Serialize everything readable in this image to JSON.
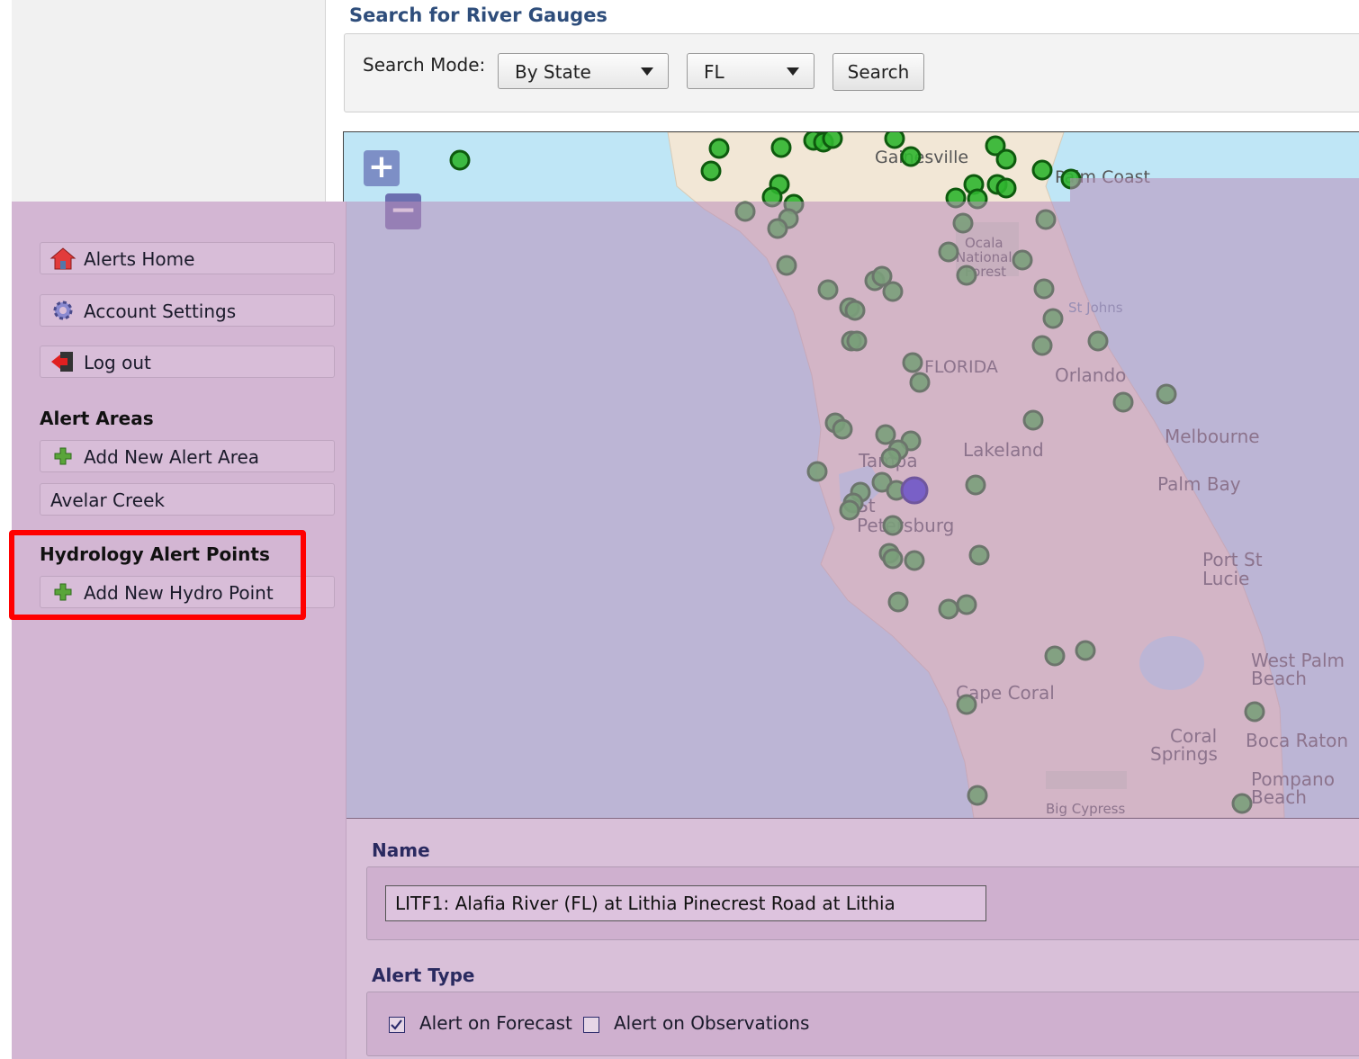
{
  "search": {
    "title": "Search for River Gauges",
    "mode_label": "Search Mode:",
    "mode_value": "By State",
    "state_value": "FL",
    "search_button": "Search"
  },
  "map": {
    "zoom_in": "+",
    "zoom_out": "−",
    "places": [
      {
        "id": "gainesville",
        "text": "Gainesville"
      },
      {
        "id": "palmcoast",
        "text": "Palm Coast"
      },
      {
        "id": "ocala",
        "text": "Ocala"
      },
      {
        "id": "ocala2",
        "text": "National"
      },
      {
        "id": "ocala3",
        "text": "Forest"
      },
      {
        "id": "stjohns",
        "text": "St Johns"
      },
      {
        "id": "florida",
        "text": "FLORIDA"
      },
      {
        "id": "orlando",
        "text": "Orlando"
      },
      {
        "id": "melbourne",
        "text": "Melbourne"
      },
      {
        "id": "lakeland",
        "text": "Lakeland"
      },
      {
        "id": "tampa",
        "text": "Tampa"
      },
      {
        "id": "palmbay",
        "text": "Palm Bay"
      },
      {
        "id": "st",
        "text": "St"
      },
      {
        "id": "petersburg",
        "text": "Petersburg"
      },
      {
        "id": "portst",
        "text": "Port St"
      },
      {
        "id": "lucie",
        "text": "Lucie"
      },
      {
        "id": "westpalm",
        "text": "West Palm"
      },
      {
        "id": "beach1",
        "text": "Beach"
      },
      {
        "id": "capecoral",
        "text": "Cape Coral"
      },
      {
        "id": "coral",
        "text": "Coral"
      },
      {
        "id": "springs",
        "text": "Springs"
      },
      {
        "id": "bocaraton",
        "text": "Boca Raton"
      },
      {
        "id": "pompano",
        "text": "Pompano"
      },
      {
        "id": "beach2",
        "text": "Beach"
      },
      {
        "id": "bigcypress",
        "text": "Big Cypress"
      }
    ],
    "marker_color": "#2fb52f",
    "selected_marker_color": "#2a2ad8"
  },
  "sidebar": {
    "alerts_home": "Alerts Home",
    "account_settings": "Account Settings",
    "log_out": "Log out",
    "alert_areas_heading": "Alert Areas",
    "add_alert_area": "Add New Alert Area",
    "alert_area_item": "Avelar Creek",
    "hydro_heading": "Hydrology Alert Points",
    "add_hydro_point": "Add New Hydro Point"
  },
  "form": {
    "name_label": "Name",
    "name_value": "LITF1: Alafia River (FL) at Lithia Pinecrest Road at Lithia",
    "alert_type_label": "Alert Type",
    "forecast_label": "Alert on Forecast",
    "forecast_checked": true,
    "observations_label": "Alert on Observations",
    "observations_checked": false
  }
}
